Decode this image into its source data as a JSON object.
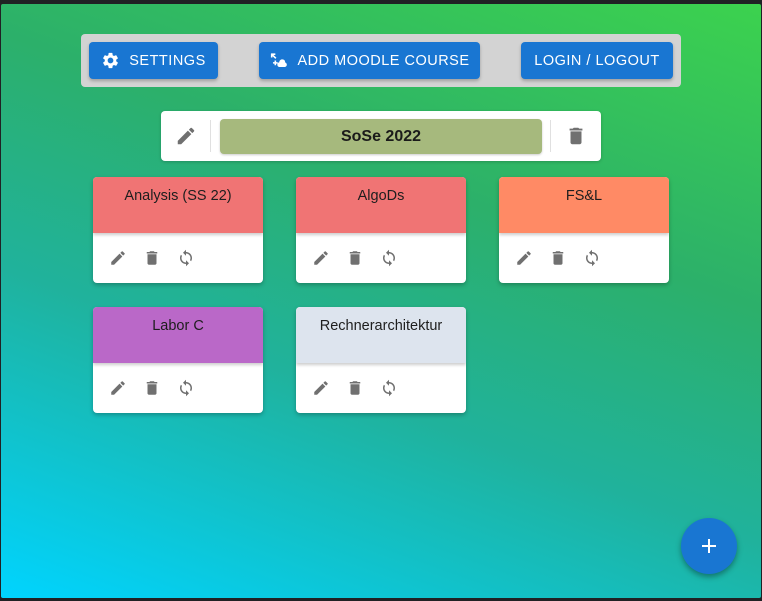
{
  "toolbar": {
    "settings_label": "SETTINGS",
    "add_moodle_label": "ADD MOODLE COURSE",
    "login_label": "LOGIN / LOGOUT"
  },
  "semester": {
    "title": "SoSe 2022",
    "title_color": "#a6b97d"
  },
  "courses": [
    {
      "name": "Analysis (SS 22)",
      "color": "#f07474"
    },
    {
      "name": "AlgoDs",
      "color": "#f07474"
    },
    {
      "name": "FS&L",
      "color": "#ff8a65"
    },
    {
      "name": "Labor C",
      "color": "#ba68c8"
    },
    {
      "name": "Rechnerarchitektur",
      "color": "#dde4ee"
    }
  ],
  "icons": {
    "settings": "gear-icon",
    "add_moodle": "add-course-icon",
    "edit": "pencil-icon",
    "delete": "trash-icon",
    "sync": "sync-icon",
    "fab": "plus-icon"
  },
  "colors": {
    "primary": "#1976d2",
    "toolbar_bg": "#d3d3d3"
  }
}
